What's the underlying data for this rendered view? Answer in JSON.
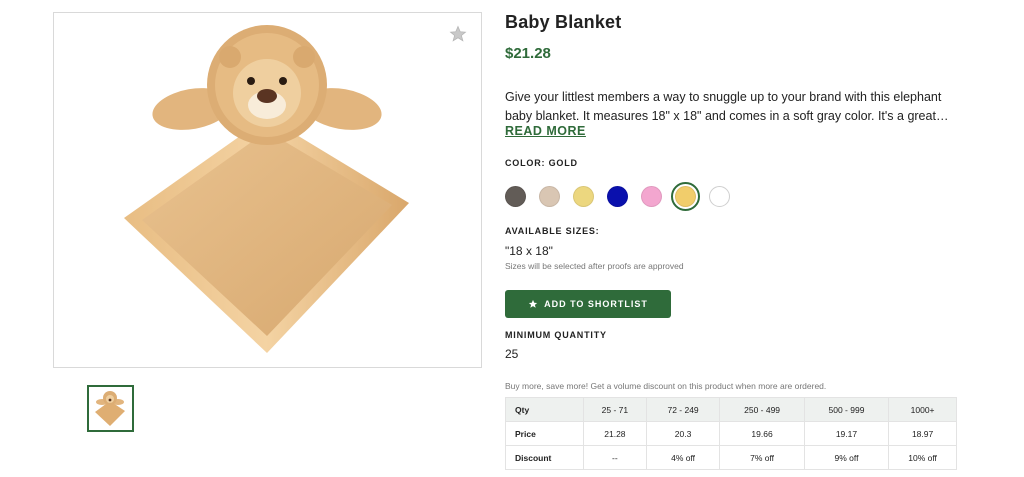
{
  "product": {
    "title": "Baby Blanket",
    "price": "$21.28",
    "description": "Give your littlest members a way to snuggle up to your brand with this elephant baby blanket. It measures 18\" x 18\" and comes in a soft gray color. It's a great way to launch your next campaign or welcome new members.",
    "read_more": "READ MORE"
  },
  "gallery": {
    "favorite_icon": "star-icon",
    "thumbnail_icon": "plush-lion-blanket-image"
  },
  "color": {
    "label": "COLOR: GOLD",
    "options": [
      {
        "name": "Charcoal",
        "hex": "#625c57"
      },
      {
        "name": "Tan",
        "hex": "#d9c6b3"
      },
      {
        "name": "Yellow",
        "hex": "#ecd77f"
      },
      {
        "name": "Royal Blue",
        "hex": "#0a10ad"
      },
      {
        "name": "Pink",
        "hex": "#f3a6cf"
      },
      {
        "name": "Gold",
        "hex": "#f1cd6b",
        "selected": true
      },
      {
        "name": "White",
        "hex": "#ffffff"
      }
    ]
  },
  "sizes": {
    "label": "AVAILABLE SIZES:",
    "value": "\"18 x 18\"",
    "note": "Sizes will be selected after proofs are approved"
  },
  "shortlist": {
    "label": "ADD TO SHORTLIST",
    "icon": "star-icon"
  },
  "minimum": {
    "label": "MINIMUM QUANTITY",
    "value": "25"
  },
  "volume": {
    "note": "Buy more, save more! Get a volume discount on this product when more are ordered.",
    "header": [
      "Qty",
      "25 - 71",
      "72 - 249",
      "250 - 499",
      "500 - 999",
      "1000+"
    ],
    "price_row": [
      "Price",
      "21.28",
      "20.3",
      "19.66",
      "19.17",
      "18.97"
    ],
    "discount_row": [
      "Discount",
      "--",
      "4% off",
      "7% off",
      "9% off",
      "10% off"
    ]
  },
  "colors": {
    "accent": "#2f6b3a",
    "table_header_bg": "#eef1ef"
  }
}
